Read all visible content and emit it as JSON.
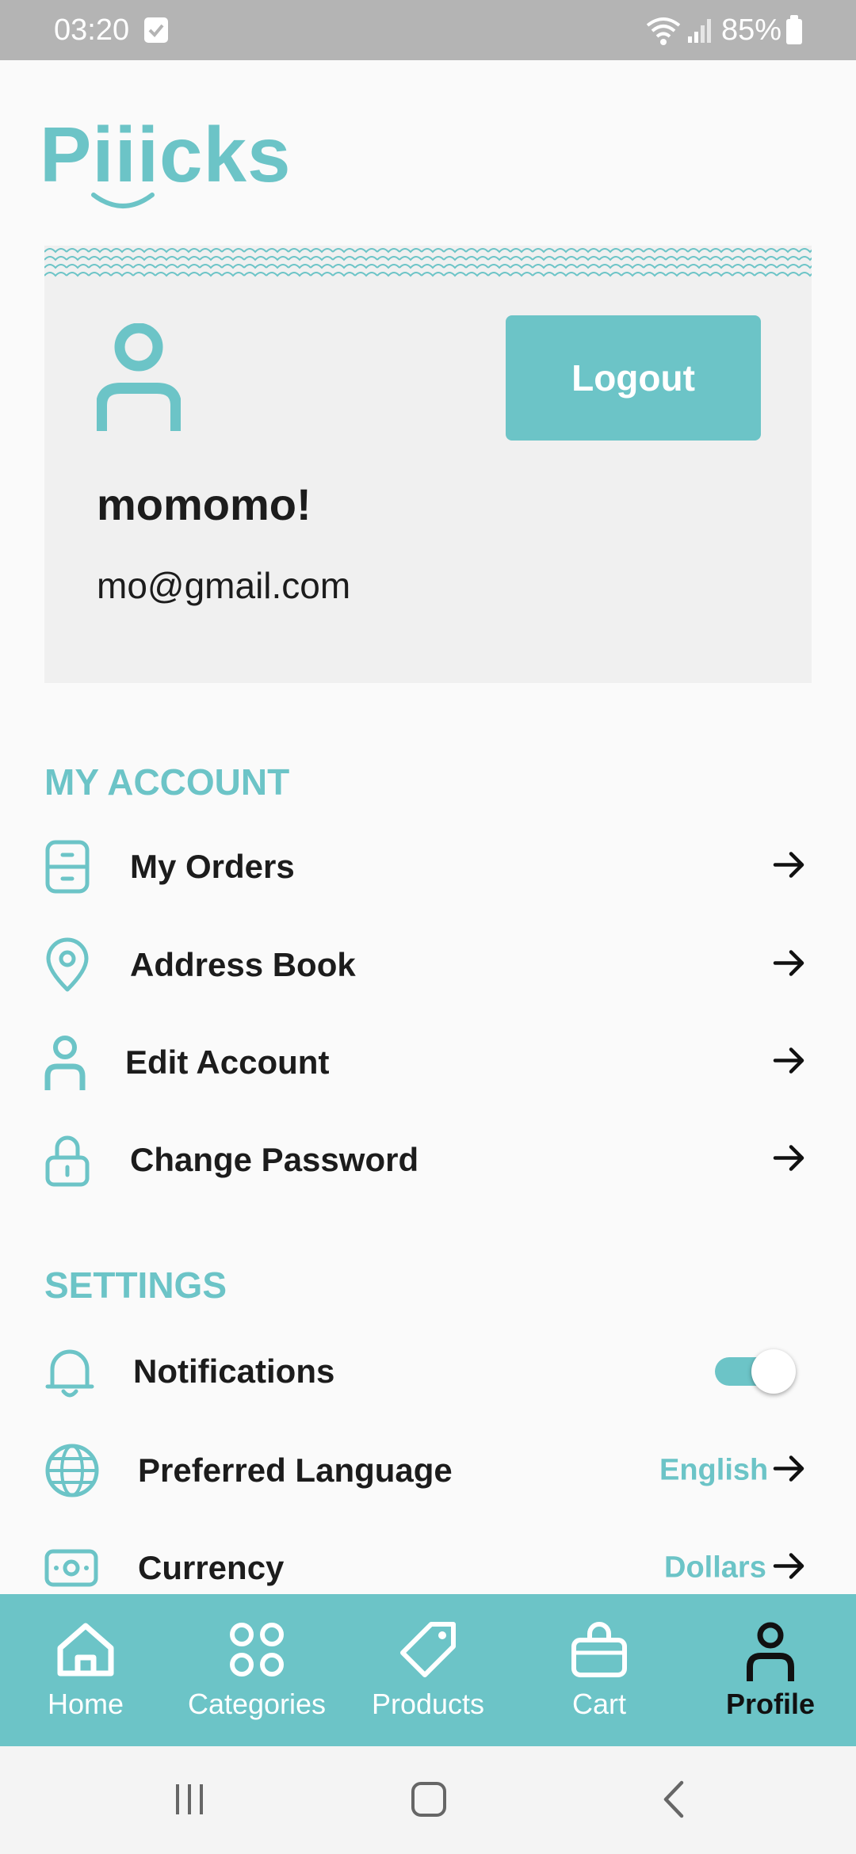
{
  "status_bar": {
    "time": "03:20",
    "battery": "85%",
    "icons": [
      "check-icon",
      "wifi-icon",
      "signal-icon",
      "battery-icon"
    ]
  },
  "app": {
    "logo_text": "Piiicks",
    "accent_color": "#6cc4c7"
  },
  "profile": {
    "name": "momomo!",
    "email": "mo@gmail.com",
    "logout_label": "Logout"
  },
  "my_account": {
    "title": "MY ACCOUNT",
    "items": [
      {
        "label": "My Orders",
        "icon": "orders-icon"
      },
      {
        "label": "Address Book",
        "icon": "location-pin-icon"
      },
      {
        "label": "Edit Account",
        "icon": "user-icon"
      },
      {
        "label": "Change Password",
        "icon": "lock-icon"
      }
    ]
  },
  "settings": {
    "title": "SETTINGS",
    "notifications": {
      "label": "Notifications",
      "enabled": true
    },
    "language": {
      "label": "Preferred Language",
      "value": "English"
    },
    "currency": {
      "label": "Currency",
      "value": "Dollars"
    }
  },
  "bottom_nav": {
    "active": "Profile",
    "items": [
      {
        "label": "Home",
        "icon": "home-icon"
      },
      {
        "label": "Categories",
        "icon": "categories-icon"
      },
      {
        "label": "Products",
        "icon": "tag-icon"
      },
      {
        "label": "Cart",
        "icon": "bag-icon"
      },
      {
        "label": "Profile",
        "icon": "profile-icon"
      }
    ]
  },
  "system_nav": {
    "icons": [
      "recents-icon",
      "home-button-icon",
      "back-icon"
    ]
  }
}
